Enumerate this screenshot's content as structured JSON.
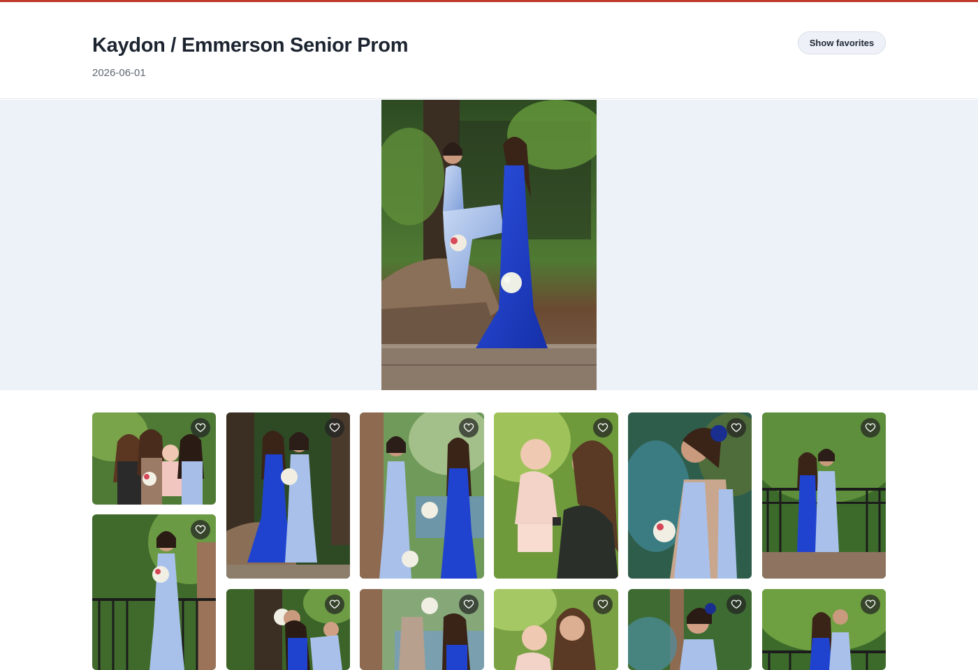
{
  "gallery": {
    "title": "Kaydon / Emmerson Senior Prom",
    "date": "2026-06-01",
    "show_favorites_label": "Show favorites"
  },
  "hero": {
    "icon": "photo"
  },
  "thumbnails": [
    {
      "id": "t1",
      "scene": "three-women-baby",
      "favorite": false
    },
    {
      "id": "t2",
      "scene": "blue-sequin-pair",
      "favorite": false
    },
    {
      "id": "t3",
      "scene": "pair-by-brick-column",
      "favorite": false
    },
    {
      "id": "t4",
      "scene": "woman-holding-baby",
      "favorite": false
    },
    {
      "id": "t5",
      "scene": "profile-portrait",
      "favorite": false
    },
    {
      "id": "t6",
      "scene": "pair-at-railing",
      "favorite": false
    },
    {
      "id": "t7",
      "scene": "single-at-railing",
      "favorite": false
    },
    {
      "id": "t8",
      "scene": "pair-bending",
      "favorite": false
    },
    {
      "id": "t9",
      "scene": "bouquet-raised",
      "favorite": false
    },
    {
      "id": "t10",
      "scene": "woman-baby-smiling",
      "favorite": false
    },
    {
      "id": "t11",
      "scene": "portrait-front",
      "favorite": false
    },
    {
      "id": "t12",
      "scene": "pair-at-railing-2",
      "favorite": false
    }
  ],
  "colors": {
    "accent": "#c0392b",
    "hero_band": "#edf1f8",
    "royal_blue_dress": "#1f3fc4",
    "pale_blue_dress": "#a9c1ea",
    "foliage": "#3f6e2a",
    "heart_badge": "#222222"
  }
}
